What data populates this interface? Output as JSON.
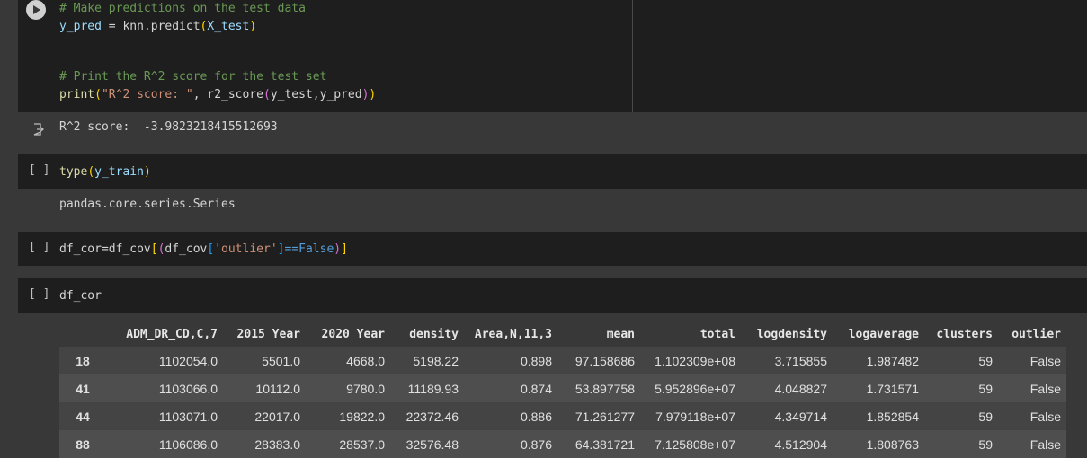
{
  "cell1": {
    "line1": "# Make predictions on the test data",
    "line2_var": "y_pred",
    "line2_eq": " = knn.predict",
    "line2_open": "(",
    "line2_arg": "X_test",
    "line2_close": ")",
    "line4": "# Print the R^2 score for the test set",
    "line5_fn": "print",
    "line5_open": "(",
    "line5_str": "\"R^2 score: \"",
    "line5_mid": ", r2_score",
    "line5_open2": "(",
    "line5_args": "y_test,y_pred",
    "line5_close2": ")",
    "line5_close": ")"
  },
  "cell1_output": "R^2 score:  -3.9823218415512693",
  "cell2": {
    "bracket": "[ ]",
    "fn": "type",
    "open": "(",
    "arg": "y_train",
    "close": ")",
    "output": "pandas.core.series.Series"
  },
  "cell3": {
    "bracket": "[ ]",
    "a": "df_cor=df_cov",
    "b": "[",
    "c": "(",
    "d": "df_cov",
    "e": "[",
    "f": "'outlier'",
    "g": "]",
    "h": "==False",
    "i": ")",
    "j": "]"
  },
  "cell4": {
    "bracket": "[ ]",
    "code": "df_cor"
  },
  "table": {
    "columns": [
      "",
      "ADM_DR_CD,C,7",
      "2015 Year",
      "2020 Year",
      "density",
      "Area,N,11,3",
      "mean",
      "total",
      "logdensity",
      "logaverage",
      "clusters",
      "outlier"
    ],
    "rows": [
      [
        "18",
        "1102054.0",
        "5501.0",
        "4668.0",
        "5198.22",
        "0.898",
        "97.158686",
        "1.102309e+08",
        "3.715855",
        "1.987482",
        "59",
        "False"
      ],
      [
        "41",
        "1103066.0",
        "10112.0",
        "9780.0",
        "11189.93",
        "0.874",
        "53.897758",
        "5.952896e+07",
        "4.048827",
        "1.731571",
        "59",
        "False"
      ],
      [
        "44",
        "1103071.0",
        "22017.0",
        "19822.0",
        "22372.46",
        "0.886",
        "71.261277",
        "7.979118e+07",
        "4.349714",
        "1.852854",
        "59",
        "False"
      ],
      [
        "88",
        "1106086.0",
        "28383.0",
        "28537.0",
        "32576.48",
        "0.876",
        "64.381721",
        "7.125808e+07",
        "4.512904",
        "1.808763",
        "59",
        "False"
      ]
    ]
  }
}
